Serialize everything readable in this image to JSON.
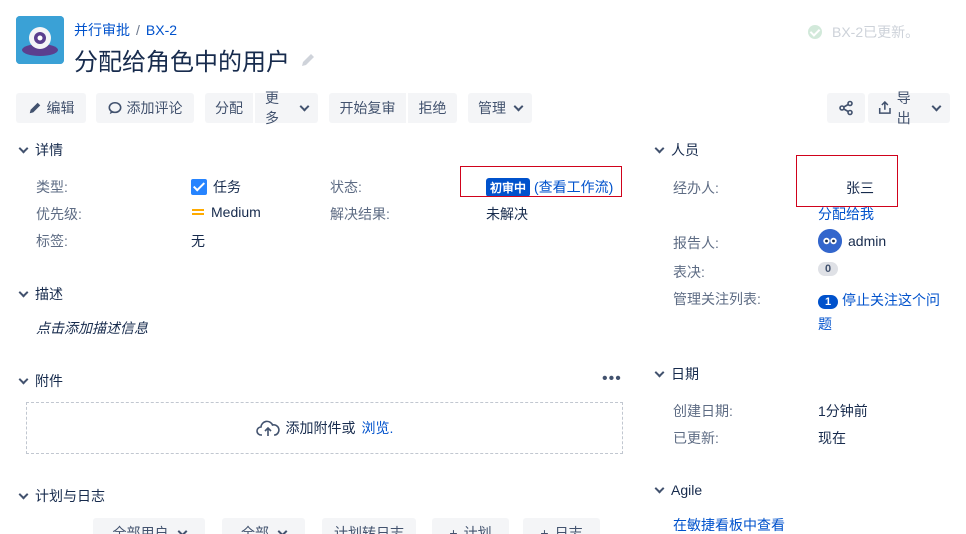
{
  "header": {
    "breadcrumb_project": "并行审批",
    "breadcrumb_sep": "/",
    "breadcrumb_issue": "BX-2",
    "title": "分配给角色中的用户",
    "flag_text": "BX-2已更新。"
  },
  "toolbar": {
    "edit": "编辑",
    "comment": "添加评论",
    "assign": "分配",
    "more": "更多",
    "start_review": "开始复审",
    "reject": "拒绝",
    "manage": "管理",
    "export": "导出"
  },
  "details": {
    "section": "详情",
    "type_label": "类型:",
    "type_value": "任务",
    "priority_label": "优先级:",
    "priority_value": "Medium",
    "labels_label": "标签:",
    "labels_value": "无",
    "status_label": "状态:",
    "status_value": "初审中",
    "status_link": "(查看工作流)",
    "resolution_label": "解决结果:",
    "resolution_value": "未解决"
  },
  "description": {
    "section": "描述",
    "placeholder": "点击添加描述信息"
  },
  "attachments": {
    "section": "附件",
    "more": "•••",
    "drop_text": "添加附件或",
    "browse": "浏览."
  },
  "worklog": {
    "section": "计划与日志",
    "buttons": [
      "全部用户",
      "全部",
      "计划转日志",
      "计划",
      "日志"
    ]
  },
  "people": {
    "section": "人员",
    "assignee_label": "经办人:",
    "assignee_value": "张三",
    "assign_to_me": "分配给我",
    "reporter_label": "报告人:",
    "reporter_value": "admin",
    "votes_label": "表决:",
    "votes_value": "0",
    "watchers_label": "管理关注列表:",
    "watchers_count": "1",
    "watchers_link": "停止关注这个问题"
  },
  "dates": {
    "section": "日期",
    "created_label": "创建日期:",
    "created_value": "1分钟前",
    "updated_label": "已更新:",
    "updated_value": "现在"
  },
  "agile": {
    "section": "Agile",
    "link": "在敏捷看板中查看"
  },
  "colors": {
    "link": "#0052cc",
    "status_lozenge": "#0052cc",
    "highlight_box": "#d0021b"
  }
}
